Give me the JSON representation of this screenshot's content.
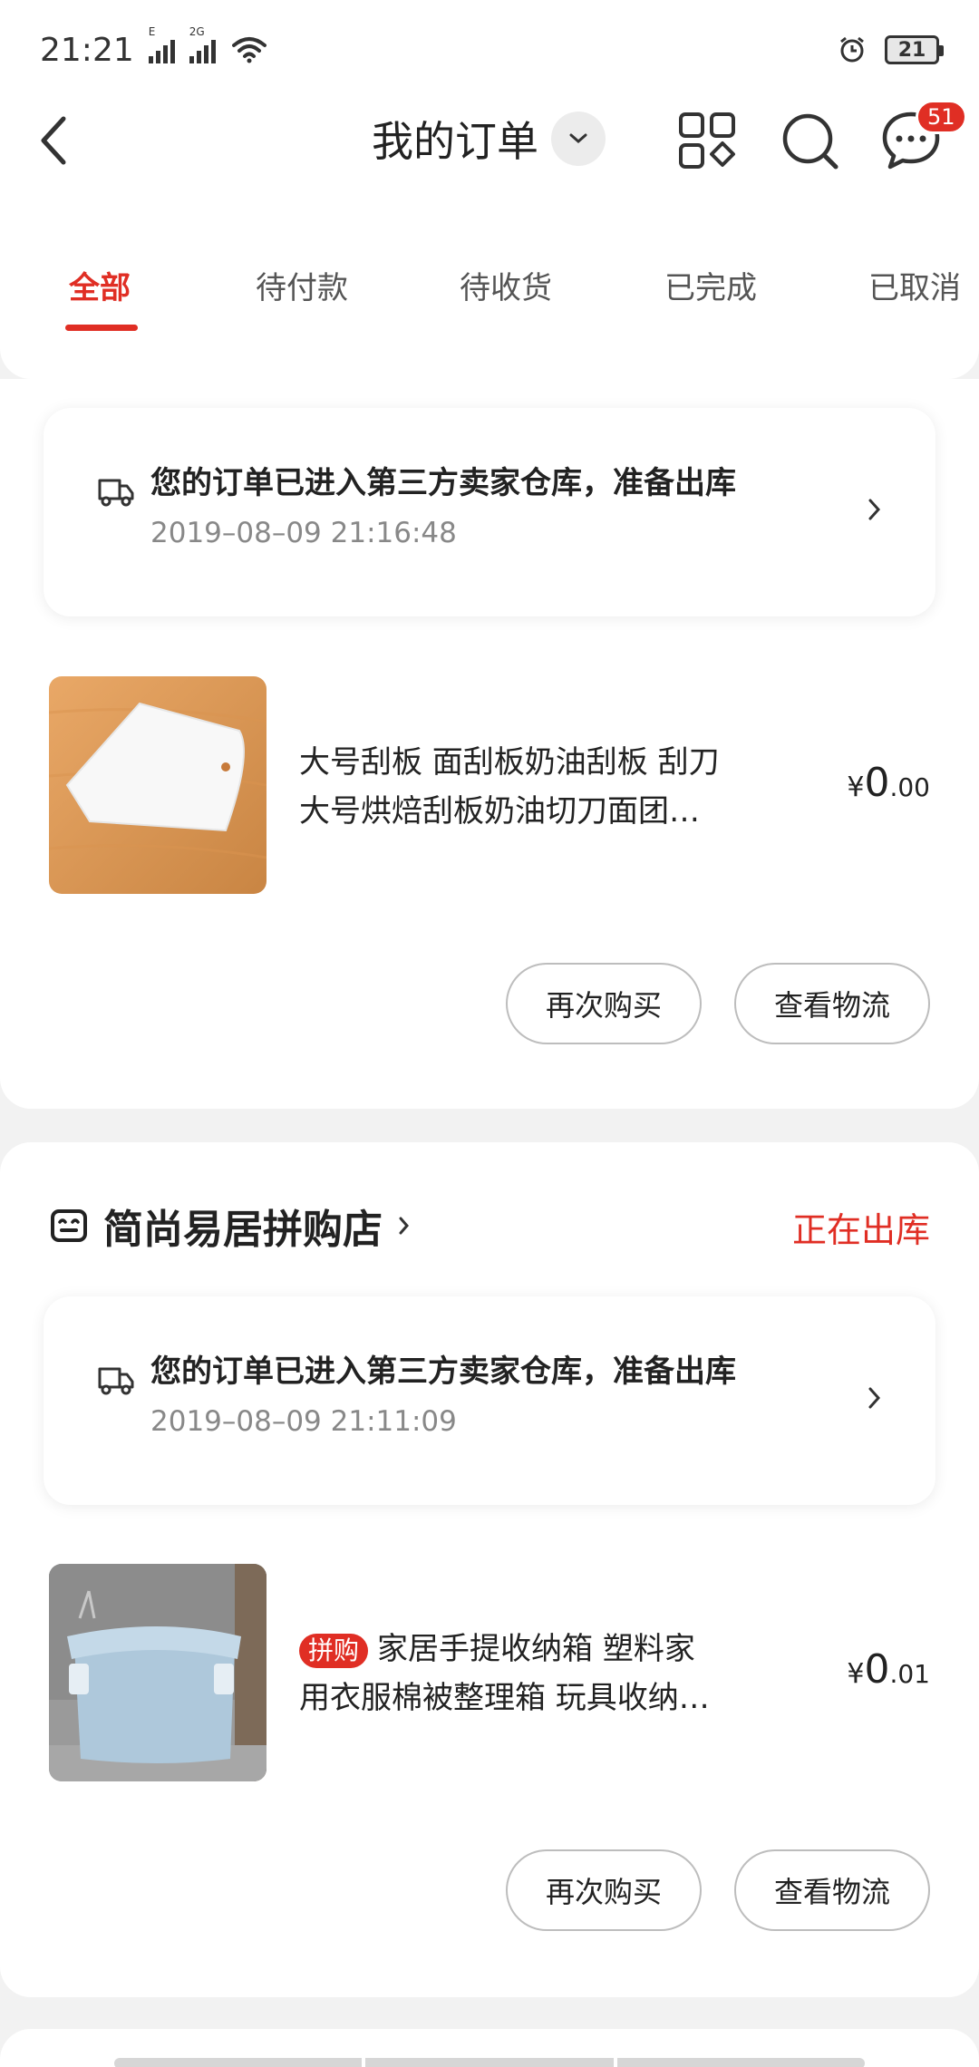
{
  "status_bar": {
    "time": "21:21",
    "signal1_label": "E",
    "signal2_label": "2G",
    "battery": "21"
  },
  "nav": {
    "title": "我的订单",
    "message_badge": "51"
  },
  "tabs": [
    "全部",
    "待付款",
    "待收货",
    "已完成",
    "已取消"
  ],
  "orders": [
    {
      "logistics_text": "您的订单已进入第三方卖家仓库，准备出库",
      "logistics_time": "2019–08–09 21:16:48",
      "product_line1": "大号刮板 面刮板奶油刮板 刮刀",
      "product_line2": "大号烘焙刮板奶油切刀面团…",
      "price_symbol": "¥",
      "price_int": "0",
      "price_dec": ".00",
      "buy_again": "再次购买",
      "view_logistics": "查看物流"
    },
    {
      "shop_name": "简尚易居拼购店",
      "shop_status": "正在出库",
      "logistics_text": "您的订单已进入第三方卖家仓库，准备出库",
      "logistics_time": "2019–08–09 21:11:09",
      "tag": "拼购",
      "product_line1": "家居手提收纳箱 塑料家",
      "product_line2": "用衣服棉被整理箱 玩具收纳…",
      "price_symbol": "¥",
      "price_int": "0",
      "price_dec": ".01",
      "buy_again": "再次购买",
      "view_logistics": "查看物流"
    }
  ],
  "colors": {
    "accent": "#e02e24",
    "background": "#f2f2f2"
  }
}
